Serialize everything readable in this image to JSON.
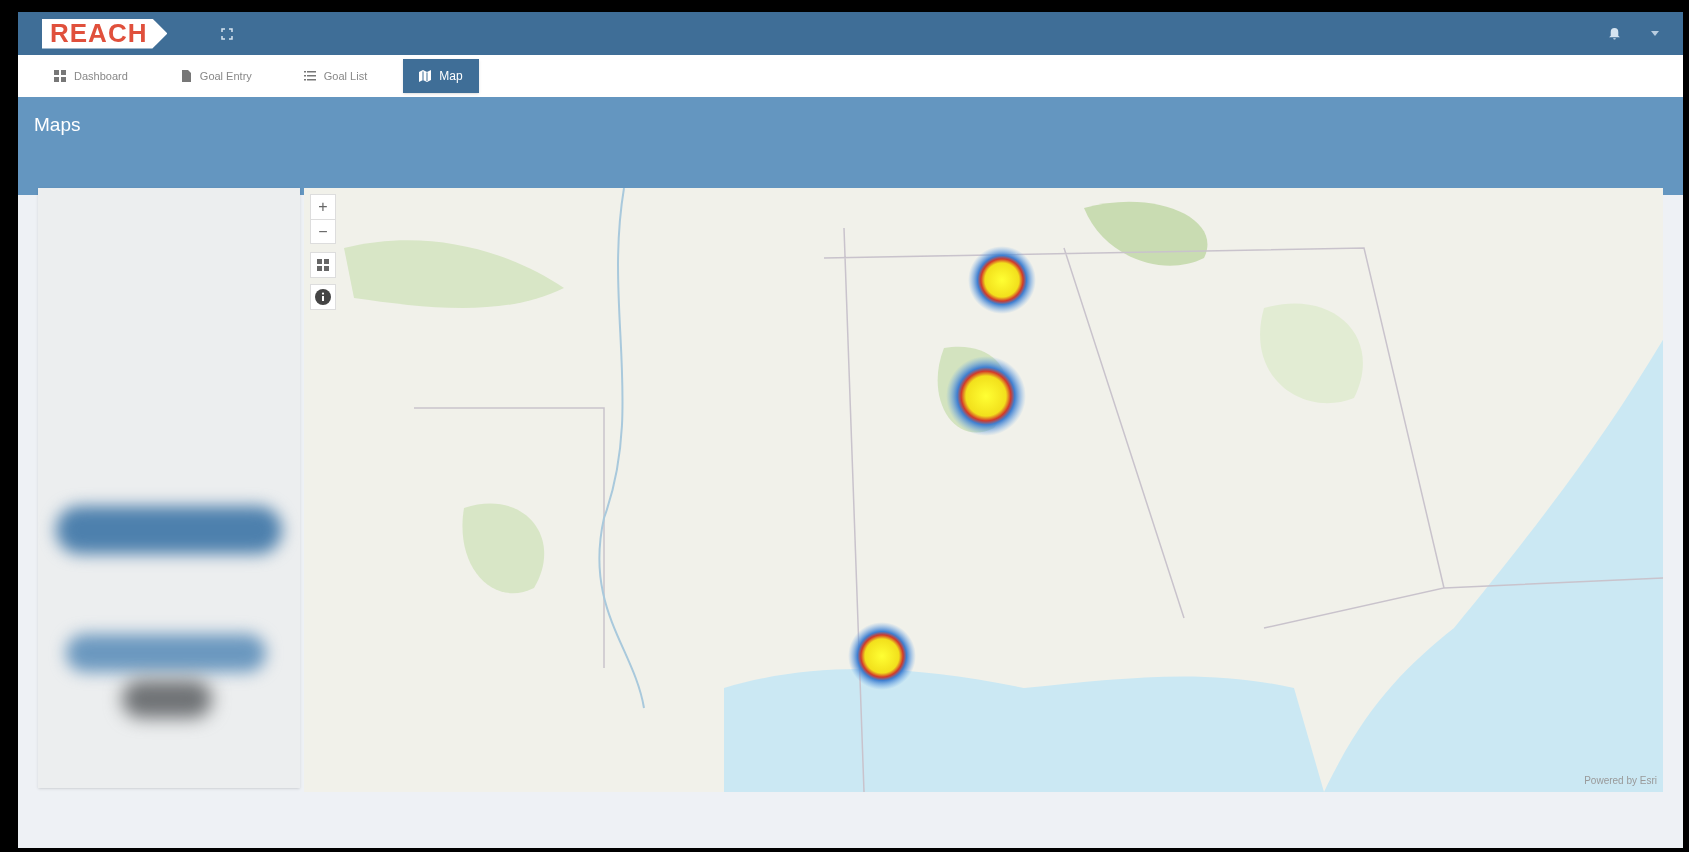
{
  "header": {
    "logo": "REACH"
  },
  "tabs": [
    {
      "label": "Dashboard",
      "selected": false
    },
    {
      "label": "Goal Entry",
      "selected": false
    },
    {
      "label": "Goal List",
      "selected": false
    },
    {
      "label": "Map",
      "selected": true
    }
  ],
  "page_title": "Maps",
  "map": {
    "zoom_in": "+",
    "zoom_out": "−",
    "attribution": "Powered by Esri"
  }
}
